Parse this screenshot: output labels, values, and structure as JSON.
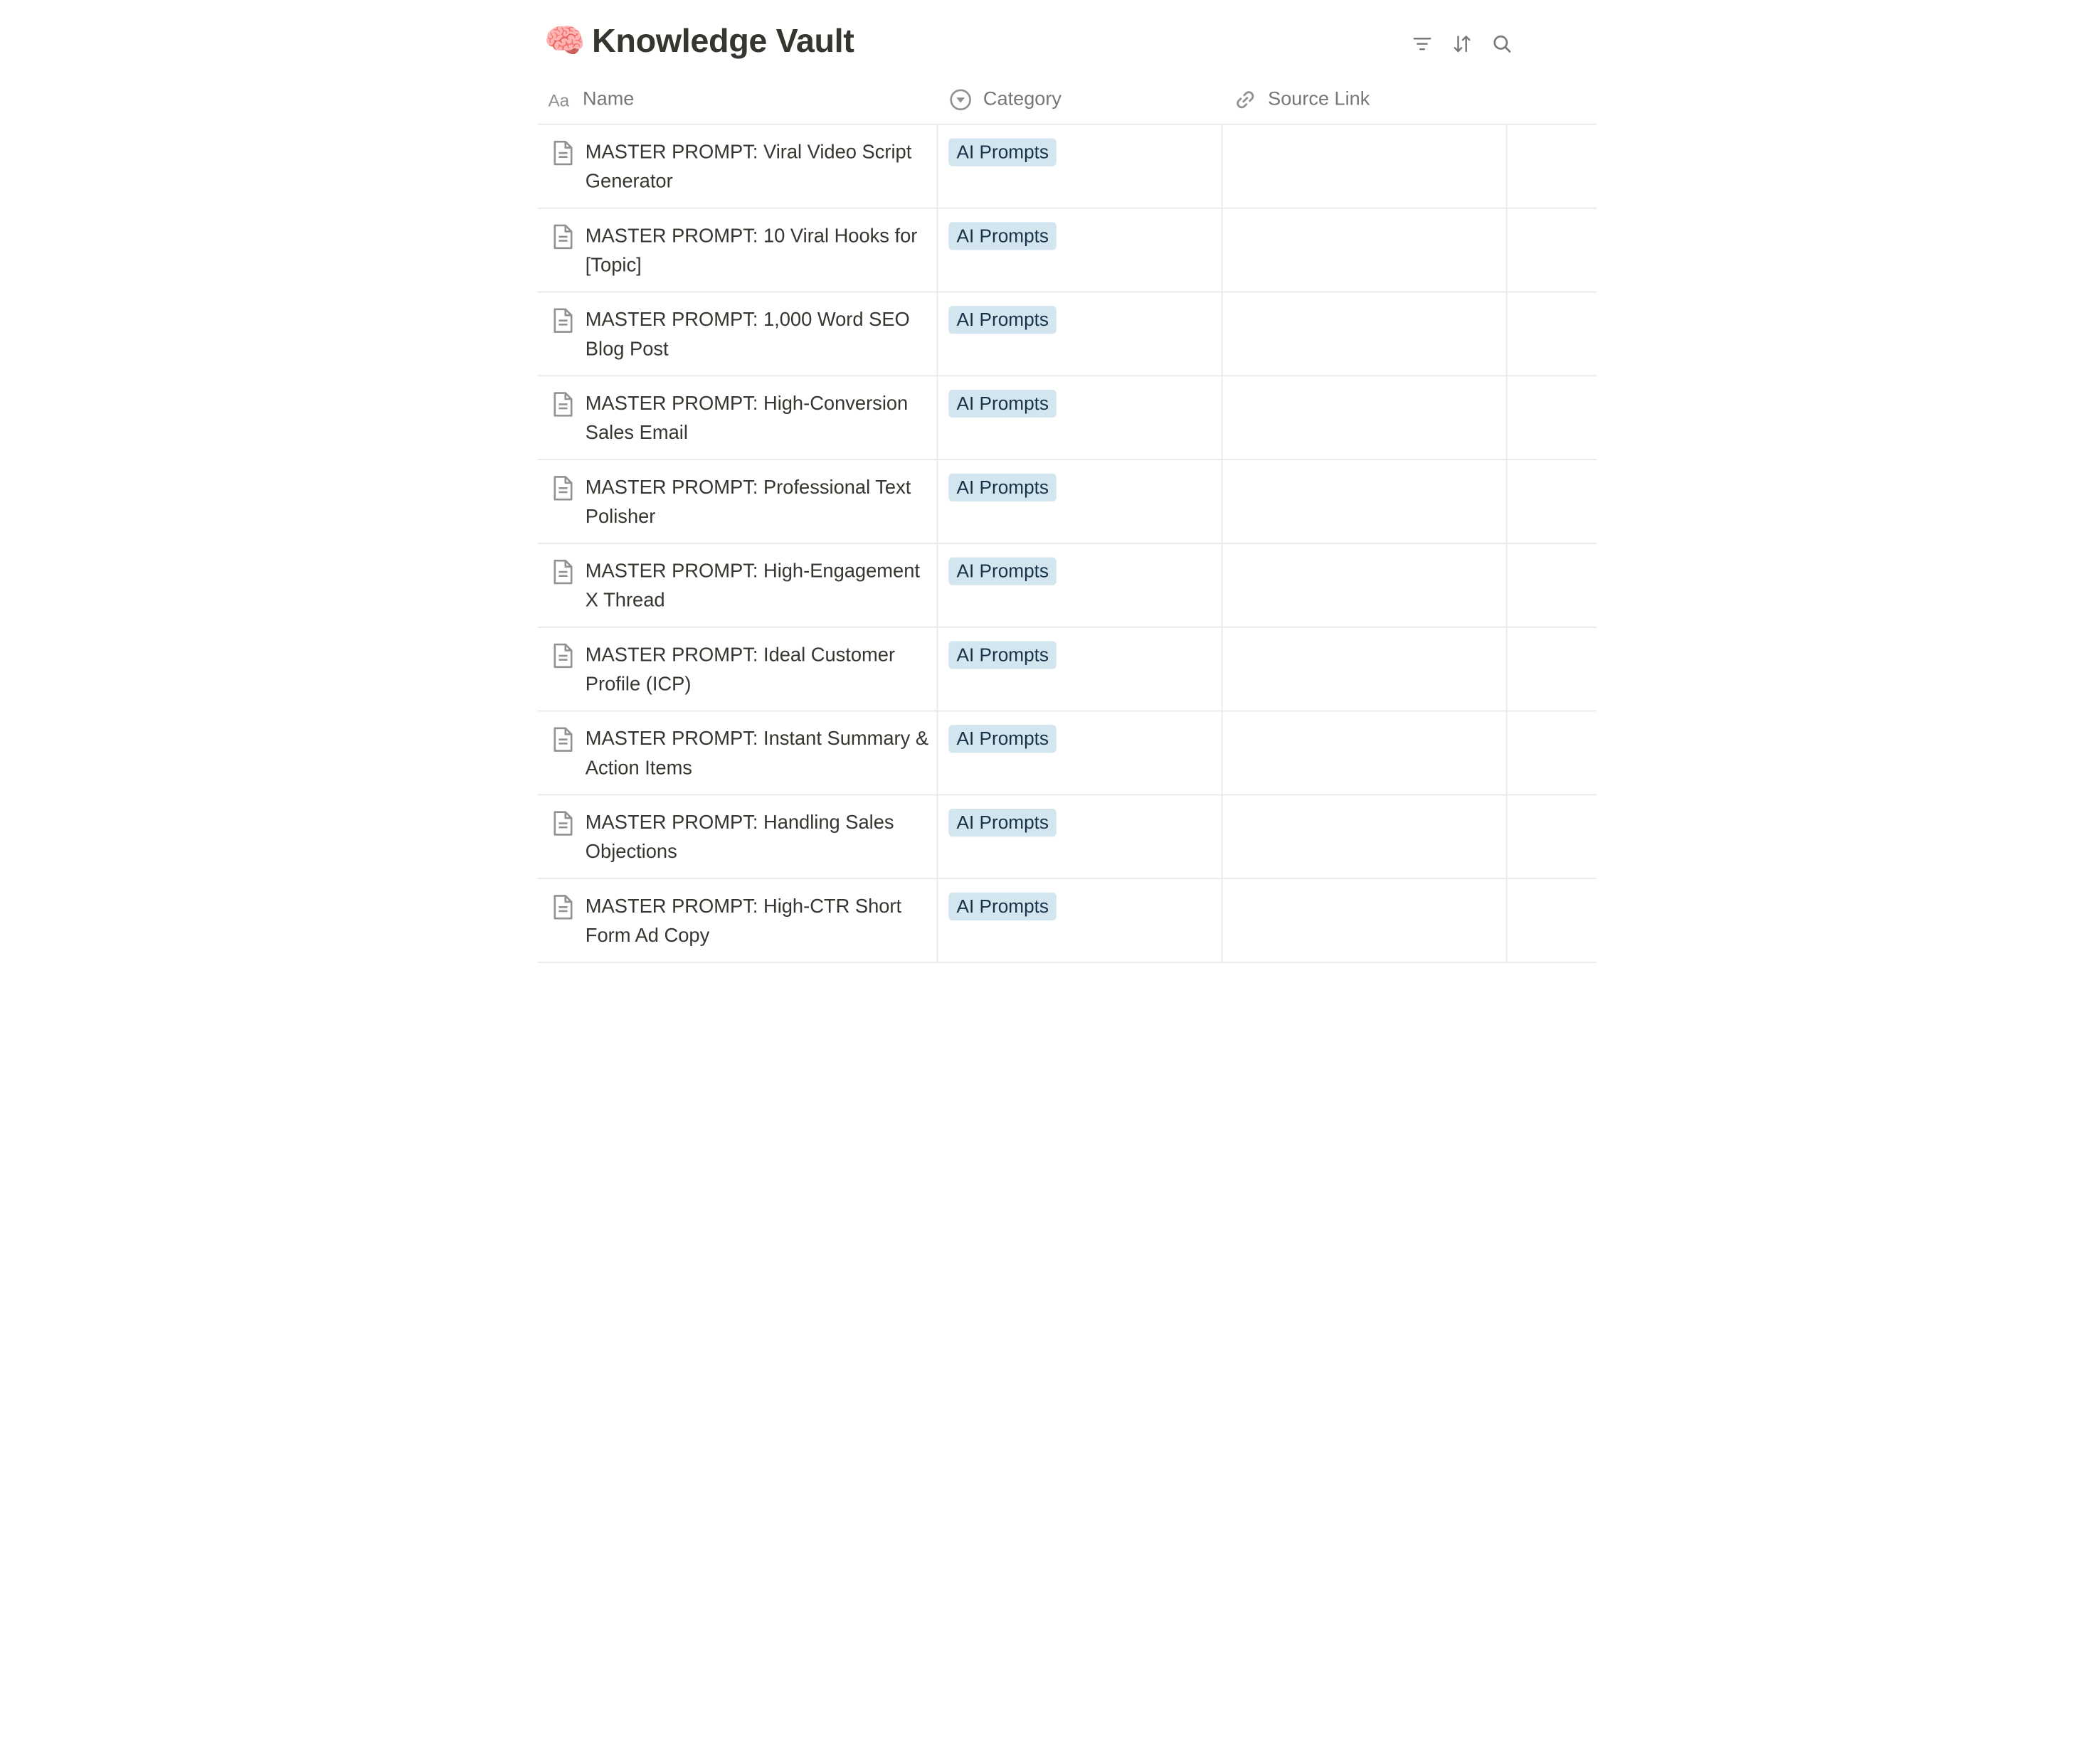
{
  "header": {
    "emoji": "🧠",
    "title": "Knowledge Vault"
  },
  "toolbar": {
    "filter_icon": "filter-icon",
    "sort_icon": "sort-icon",
    "search_icon": "search-icon"
  },
  "columns": {
    "name": {
      "label": "Name",
      "icon": "text-aa-icon"
    },
    "category": {
      "label": "Category",
      "icon": "select-chevron-icon"
    },
    "source": {
      "label": "Source Link",
      "icon": "link-icon"
    }
  },
  "colors": {
    "tag_bg": "#d3e5ef",
    "tag_text": "#183347",
    "border": "#e9e9e7"
  },
  "rows": [
    {
      "name": "MASTER PROMPT: Viral Video Script Generator",
      "category": "AI Prompts",
      "source": ""
    },
    {
      "name": "MASTER PROMPT: 10 Viral Hooks for [Topic]",
      "category": "AI Prompts",
      "source": ""
    },
    {
      "name": "MASTER PROMPT: 1,000 Word SEO Blog Post",
      "category": "AI Prompts",
      "source": ""
    },
    {
      "name": "MASTER PROMPT: High-Conversion Sales Email",
      "category": "AI Prompts",
      "source": ""
    },
    {
      "name": "MASTER PROMPT: Professional Text Polisher",
      "category": "AI Prompts",
      "source": ""
    },
    {
      "name": "MASTER PROMPT: High-Engagement X Thread",
      "category": "AI Prompts",
      "source": ""
    },
    {
      "name": "MASTER PROMPT: Ideal Customer Profile (ICP)",
      "category": "AI Prompts",
      "source": ""
    },
    {
      "name": "MASTER PROMPT: Instant Summary & Action Items",
      "category": "AI Prompts",
      "source": ""
    },
    {
      "name": "MASTER PROMPT: Handling Sales Objections",
      "category": "AI Prompts",
      "source": ""
    },
    {
      "name": "MASTER PROMPT: High-CTR Short Form Ad Copy",
      "category": "AI Prompts",
      "source": ""
    }
  ]
}
